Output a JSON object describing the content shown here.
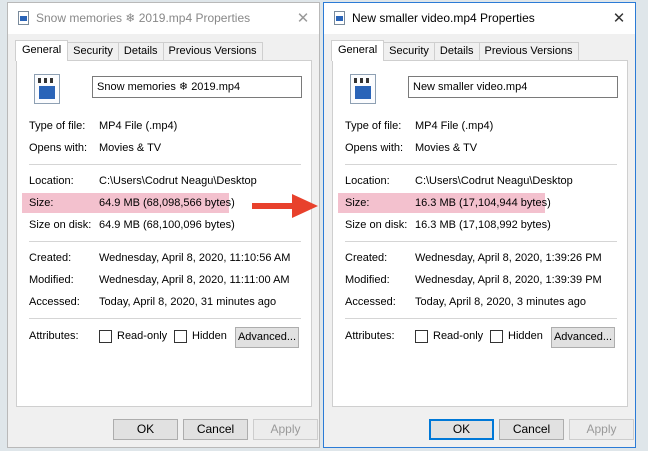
{
  "windows": [
    {
      "title": "Snow memories ❄ 2019.mp4 Properties",
      "tabs": [
        "General",
        "Security",
        "Details",
        "Previous Versions"
      ],
      "file_name": "Snow memories ❄ 2019.mp4",
      "type_label": "Type of file:",
      "type_value": "MP4 File (.mp4)",
      "opens_label": "Opens with:",
      "opens_value": "Movies & TV",
      "location_label": "Location:",
      "location_value": "C:\\Users\\Codrut Neagu\\Desktop",
      "size_label": "Size:",
      "size_value": "64.9 MB (68,098,566 bytes)",
      "disk_label": "Size on disk:",
      "disk_value": "64.9 MB (68,100,096 bytes)",
      "created_label": "Created:",
      "created_value": "Wednesday, April 8, 2020, 11:10:56 AM",
      "modified_label": "Modified:",
      "modified_value": "Wednesday, April 8, 2020, 11:11:00 AM",
      "accessed_label": "Accessed:",
      "accessed_value": "Today, April 8, 2020, 31 minutes ago",
      "attributes_label": "Attributes:",
      "readonly_label": "Read-only",
      "hidden_label": "Hidden",
      "advanced_label": "Advanced...",
      "ok_label": "OK",
      "cancel_label": "Cancel",
      "apply_label": "Apply"
    },
    {
      "title": "New smaller video.mp4 Properties",
      "tabs": [
        "General",
        "Security",
        "Details",
        "Previous Versions"
      ],
      "file_name": "New smaller video.mp4",
      "type_label": "Type of file:",
      "type_value": "MP4 File (.mp4)",
      "opens_label": "Opens with:",
      "opens_value": "Movies & TV",
      "location_label": "Location:",
      "location_value": "C:\\Users\\Codrut Neagu\\Desktop",
      "size_label": "Size:",
      "size_value": "16.3 MB (17,104,944 bytes)",
      "disk_label": "Size on disk:",
      "disk_value": "16.3 MB (17,108,992 bytes)",
      "created_label": "Created:",
      "created_value": "Wednesday, April 8, 2020, 1:39:26 PM",
      "modified_label": "Modified:",
      "modified_value": "Wednesday, April 8, 2020, 1:39:39 PM",
      "accessed_label": "Accessed:",
      "accessed_value": "Today, April 8, 2020, 3 minutes ago",
      "attributes_label": "Attributes:",
      "readonly_label": "Read-only",
      "hidden_label": "Hidden",
      "advanced_label": "Advanced...",
      "ok_label": "OK",
      "cancel_label": "Cancel",
      "apply_label": "Apply"
    }
  ],
  "colors": {
    "highlight": "#f3c1ce",
    "arrow": "#e8412c",
    "active_window_border": "#2b7bd6"
  },
  "icons": {
    "title": "video-file-icon",
    "file": "video-file-icon",
    "arrow": "arrow-right-icon"
  }
}
